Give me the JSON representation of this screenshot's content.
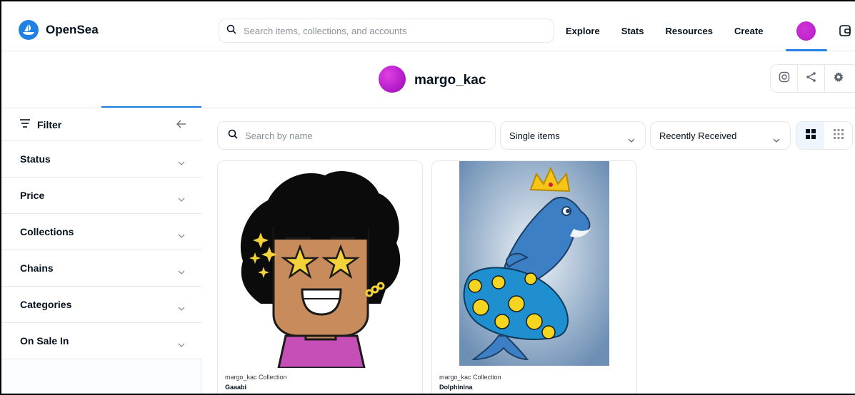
{
  "brand": {
    "name": "OpenSea",
    "color": "#2081e2"
  },
  "search": {
    "placeholder": "Search items, collections, and accounts"
  },
  "nav": {
    "links": [
      "Explore",
      "Stats",
      "Resources",
      "Create"
    ]
  },
  "icons": {
    "search": "search-icon",
    "wallet": "wallet-icon",
    "instagram": "instagram-icon",
    "share": "share-icon",
    "settings": "gear-icon",
    "filter": "filter-icon",
    "collapse": "arrow-left-icon",
    "chevron": "chevron-down-icon",
    "grid_large": "grid-large-icon",
    "grid_small": "grid-small-icon"
  },
  "profile": {
    "username": "margo_kac",
    "avatar_color": "#c92ad4"
  },
  "sidebar": {
    "filter_label": "Filter",
    "facets": [
      "Status",
      "Price",
      "Collections",
      "Chains",
      "Categories",
      "On Sale In"
    ]
  },
  "toolbar": {
    "search_placeholder": "Search by name",
    "item_type": "Single items",
    "sort": "Recently Received"
  },
  "items": [
    {
      "collection": "margo_kac Collection",
      "name": "Gaaabi"
    },
    {
      "collection": "margo_kac Collection",
      "name": "Dolphinina"
    }
  ]
}
